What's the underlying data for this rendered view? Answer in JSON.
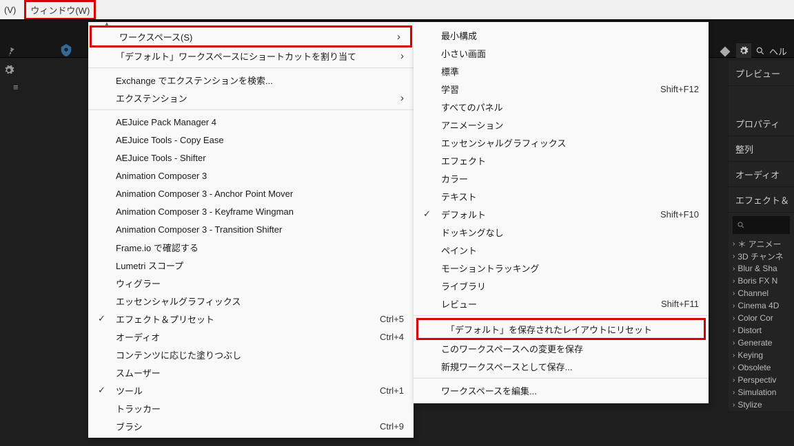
{
  "topbar": {
    "view_label": "(V)",
    "window_label": "ウィンドウ(W)"
  },
  "help_search": "ヘル",
  "right_panels": {
    "preview": "プレビュー",
    "properties": "プロパティ",
    "align": "整列",
    "audio": "オーディオ",
    "effects": "エフェクト＆"
  },
  "tree": [
    "＊ アニメー",
    "3D チャンネ",
    "Blur & Sha",
    "Boris FX N",
    "Channel",
    "Cinema 4D",
    "Color Cor",
    "Distort",
    "Generate",
    "Keying",
    "Obsolete",
    "Perspectiv",
    "Simulation",
    "Stylize"
  ],
  "menu1": {
    "workspace": "ワークスペース(S)",
    "assign_shortcut": "「デフォルト」ワークスペースにショートカットを割り当て",
    "exchange_search": "Exchange でエクステンションを検索...",
    "extension": "エクステンション",
    "aejuice_pack": "AEJuice Pack Manager 4",
    "aejuice_copy": "AEJuice Tools - Copy Ease",
    "aejuice_shifter": "AEJuice Tools - Shifter",
    "ac3": "Animation Composer 3",
    "ac3_anchor": "Animation Composer 3 - Anchor Point Mover",
    "ac3_keyframe": "Animation Composer 3 - Keyframe Wingman",
    "ac3_transition": "Animation Composer 3 - Transition Shifter",
    "frameio": "Frame.io で確認する",
    "lumetri": "Lumetri スコープ",
    "wiggler": "ウィグラー",
    "essential_graphics": "エッセンシャルグラフィックス",
    "effects_presets": "エフェクト＆プリセット",
    "effects_presets_sc": "Ctrl+5",
    "audio": "オーディオ",
    "audio_sc": "Ctrl+4",
    "content_fill": "コンテンツに応じた塗りつぶし",
    "smoother": "スムーザー",
    "tools": "ツール",
    "tools_sc": "Ctrl+1",
    "tracker": "トラッカー",
    "brush": "ブラシ",
    "brush_sc": "Ctrl+9"
  },
  "menu2": {
    "minimal": "最小構成",
    "small_screen": "小さい画面",
    "standard": "標準",
    "learn": "学習",
    "learn_sc": "Shift+F12",
    "all_panels": "すべてのパネル",
    "animation": "アニメーション",
    "essential_graphics": "エッセンシャルグラフィックス",
    "effect": "エフェクト",
    "color": "カラー",
    "text": "テキスト",
    "default": "デフォルト",
    "default_sc": "Shift+F10",
    "no_docking": "ドッキングなし",
    "paint": "ペイント",
    "motion_tracking": "モーショントラッキング",
    "library": "ライブラリ",
    "review": "レビュー",
    "review_sc": "Shift+F11",
    "reset_default": "「デフォルト」を保存されたレイアウトにリセット",
    "save_changes": "このワークスペースへの変更を保存",
    "save_as_new": "新規ワークスペースとして保存...",
    "edit_workspaces": "ワークスペースを編集..."
  }
}
